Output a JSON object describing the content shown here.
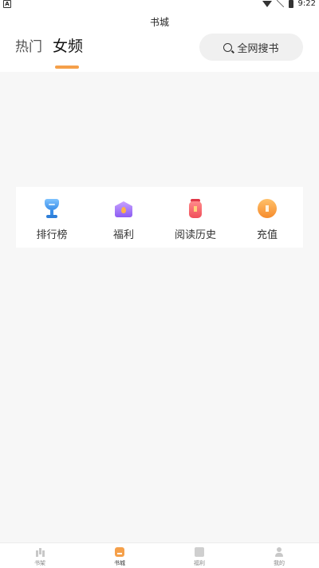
{
  "status_bar": {
    "left_icon_letter": "A",
    "time": "9:22"
  },
  "header": {
    "title": "书城",
    "tabs": [
      {
        "label": "热门",
        "active": false
      },
      {
        "label": "女频",
        "active": true
      }
    ],
    "search_label": "全网搜书"
  },
  "menu": {
    "items": [
      {
        "label": "排行榜",
        "icon": "trophy-icon"
      },
      {
        "label": "福利",
        "icon": "welfare-icon"
      },
      {
        "label": "阅读历史",
        "icon": "history-icon"
      },
      {
        "label": "充值",
        "icon": "recharge-icon"
      }
    ]
  },
  "bottom_nav": {
    "items": [
      {
        "label": "书架",
        "icon": "bookshelf-icon",
        "active": false
      },
      {
        "label": "书城",
        "icon": "bookstore-icon",
        "active": true
      },
      {
        "label": "福利",
        "icon": "gift-icon",
        "active": false
      },
      {
        "label": "我的",
        "icon": "user-icon",
        "active": false
      }
    ]
  },
  "colors": {
    "accent": "#f5a04a",
    "background": "#f7f7f7"
  }
}
